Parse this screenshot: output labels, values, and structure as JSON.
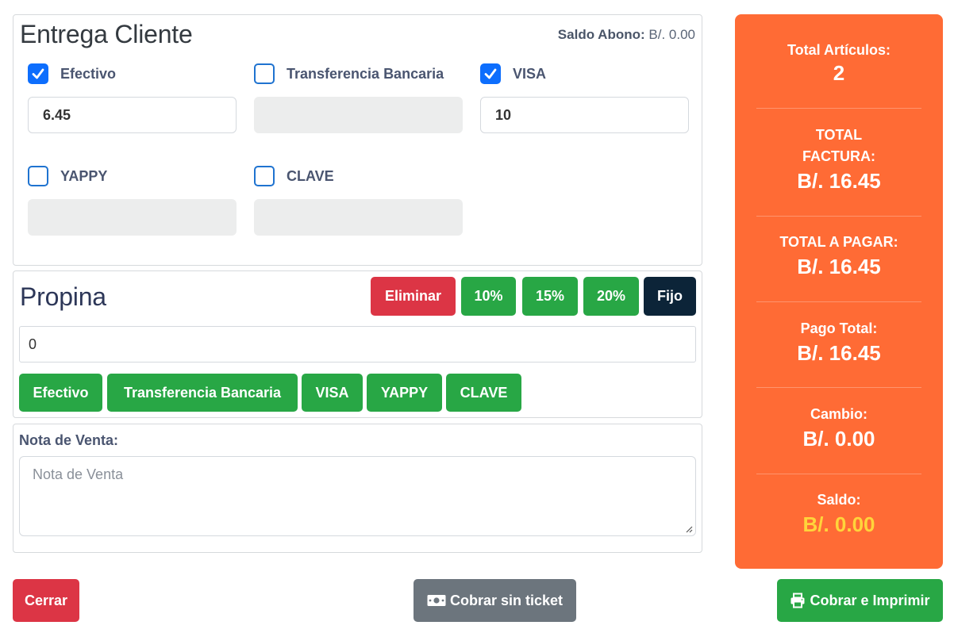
{
  "entrega": {
    "title": "Entrega Cliente",
    "saldo_abono_label": "Saldo Abono:",
    "saldo_abono_value": "B/. 0.00",
    "methods": [
      {
        "label": "Efectivo",
        "checked": true,
        "value": "6.45",
        "disabled": false
      },
      {
        "label": "Transferencia Bancaria",
        "checked": false,
        "value": "",
        "disabled": true
      },
      {
        "label": "VISA",
        "checked": true,
        "value": "10",
        "disabled": false
      },
      {
        "label": "YAPPY",
        "checked": false,
        "value": "",
        "disabled": true
      },
      {
        "label": "CLAVE",
        "checked": false,
        "value": "",
        "disabled": true
      }
    ]
  },
  "propina": {
    "title": "Propina",
    "buttons": {
      "eliminar": "Eliminar",
      "p10": "10%",
      "p15": "15%",
      "p20": "20%",
      "fijo": "Fijo"
    },
    "value": "0",
    "method_buttons": [
      "Efectivo",
      "Transferencia Bancaria",
      "VISA",
      "YAPPY",
      "CLAVE"
    ]
  },
  "nota": {
    "label": "Nota de Venta:",
    "placeholder": "Nota de Venta"
  },
  "summary": {
    "total_articulos_label": "Total Artículos:",
    "total_articulos_value": "2",
    "total_factura_label_1": "TOTAL",
    "total_factura_label_2": "FACTURA:",
    "total_factura_value": "B/. 16.45",
    "total_pagar_label": "TOTAL A PAGAR:",
    "total_pagar_value": "B/. 16.45",
    "pago_total_label": "Pago Total:",
    "pago_total_value": "B/. 16.45",
    "cambio_label": "Cambio:",
    "cambio_value": "B/. 0.00",
    "saldo_label": "Saldo:",
    "saldo_value": "B/. 0.00",
    "background_color": "#ff6b35",
    "saldo_color": "#ffd43b"
  },
  "footer": {
    "cerrar": "Cerrar",
    "cobrar_sin_ticket": "Cobrar sin ticket",
    "cobrar_imprimir": "Cobrar e Imprimir",
    "cobrar_sin_ticket_icon": "money-bill-icon",
    "cobrar_imprimir_icon": "printer-icon"
  }
}
